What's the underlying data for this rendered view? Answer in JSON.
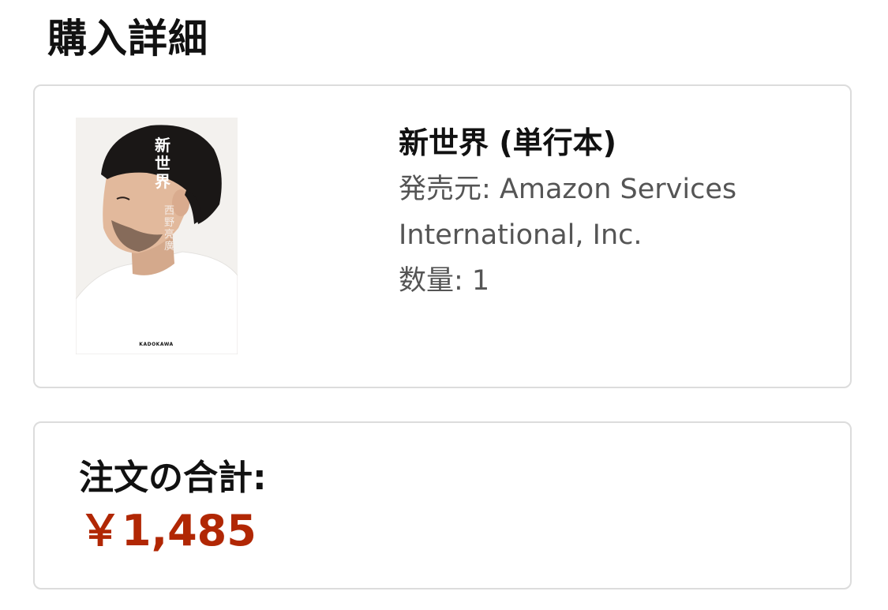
{
  "page": {
    "title": "購入詳細"
  },
  "item": {
    "cover": {
      "title_text": "新世界",
      "author_text": "西野亮廣",
      "publisher_text": "KADOKAWA"
    },
    "title": "新世界 (単行本)",
    "seller_line1": "発売元: Amazon Services",
    "seller_line2": "International, Inc.",
    "quantity": "数量: 1"
  },
  "order_total": {
    "label": "注文の合計:",
    "value": "￥1,485"
  },
  "colors": {
    "price": "#b12704",
    "card_border": "#dcdcdc",
    "meta_text": "#555555"
  }
}
